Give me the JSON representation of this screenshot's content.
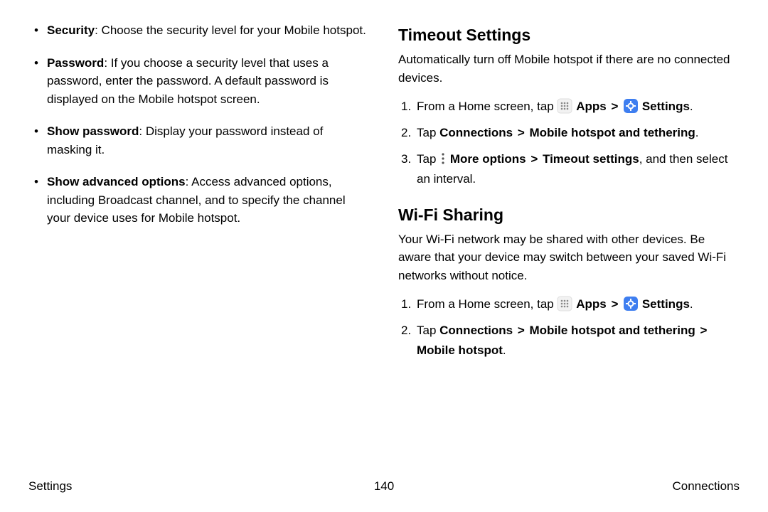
{
  "left": {
    "bullets": [
      {
        "bold": "Security",
        "rest": ": Choose the security level for your Mobile hotspot."
      },
      {
        "bold": "Password",
        "rest": ": If you choose a security level that uses a password, enter the password. A default password is displayed on the Mobile hotspot screen."
      },
      {
        "bold": "Show password",
        "rest": ": Display your password instead of masking it."
      },
      {
        "bold": "Show advanced options",
        "rest": ": Access advanced options, including Broadcast channel, and to specify the channel your device uses for Mobile hotspot."
      }
    ]
  },
  "right": {
    "timeout": {
      "heading": "Timeout Settings",
      "desc": "Automatically turn off Mobile hotspot if there are no connected devices.",
      "steps": {
        "s1a": "From a Home screen, tap ",
        "s1_apps": " Apps",
        "s1_settings": " Settings",
        "s1_period": ".",
        "s2a": "Tap ",
        "s2b": "Connections",
        "s2c": "Mobile hotspot and tethering",
        "s2_period": ".",
        "s3a": "Tap ",
        "s3b": " More options",
        "s3c": "Timeout settings",
        "s3d": ", and then select an interval."
      }
    },
    "wifi": {
      "heading": "Wi-Fi Sharing",
      "desc": "Your Wi-Fi network may be shared with other devices. Be aware that your device may switch between your saved Wi-Fi networks without notice.",
      "steps": {
        "s1a": "From a Home screen, tap ",
        "s1_apps": " Apps",
        "s1_settings": " Settings",
        "s1_period": ".",
        "s2a": "Tap ",
        "s2b": "Connections",
        "s2c": "Mobile hotspot and tethering",
        "s2d": "Mobile hotspot",
        "s2_period": "."
      }
    }
  },
  "footer": {
    "left": "Settings",
    "page": "140",
    "right": "Connections"
  },
  "chevron": ">"
}
